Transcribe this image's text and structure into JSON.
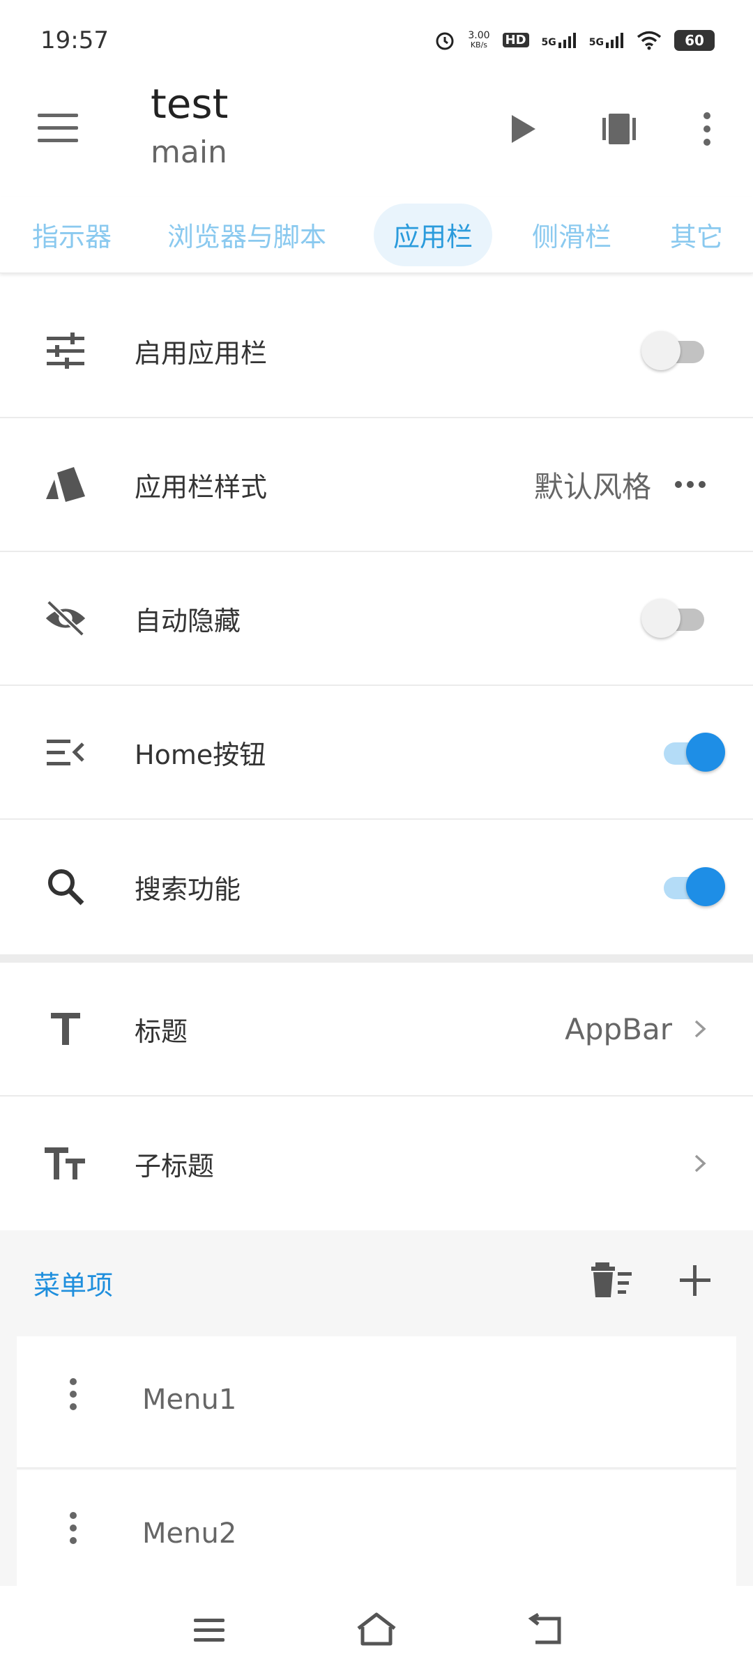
{
  "status_bar": {
    "time": "19:57",
    "net_speed_value": "3.00",
    "net_speed_unit": "KB/s",
    "hd_label": "HD",
    "signal1": "5G",
    "signal2": "5G",
    "battery": "60"
  },
  "app_bar": {
    "title": "test",
    "subtitle": "main"
  },
  "tabs": [
    {
      "label": "指示器"
    },
    {
      "label": "浏览器与脚本"
    },
    {
      "label": "应用栏",
      "active": true
    },
    {
      "label": "侧滑栏"
    },
    {
      "label": "其它"
    }
  ],
  "settings": {
    "enable_appbar": {
      "label": "启用应用栏",
      "on": false
    },
    "appbar_style": {
      "label": "应用栏样式",
      "value": "默认风格"
    },
    "auto_hide": {
      "label": "自动隐藏",
      "on": false
    },
    "home_button": {
      "label": "Home按钮",
      "on": true
    },
    "search": {
      "label": "搜索功能",
      "on": true
    },
    "title_row": {
      "label": "标题",
      "value": "AppBar"
    },
    "subtitle_row": {
      "label": "子标题"
    }
  },
  "menu": {
    "header": "菜单项",
    "items": [
      {
        "label": "Menu1"
      },
      {
        "label": "Menu2"
      }
    ]
  },
  "colors": {
    "accent": "#1e8ee6",
    "tab_active": "#2a9bdc",
    "tab_inactive": "#8ac9ef"
  }
}
